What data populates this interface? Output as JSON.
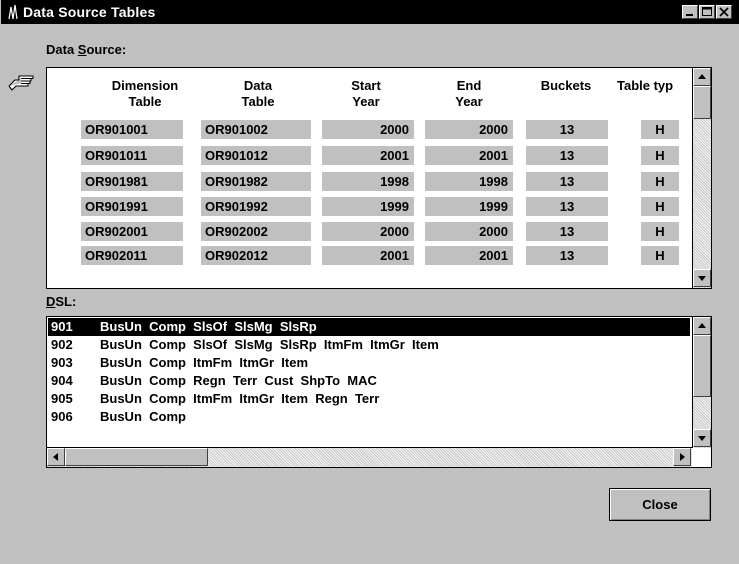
{
  "window": {
    "title": "Data Source Tables"
  },
  "labels": {
    "data_source_pre": "Data ",
    "data_source_key": "S",
    "data_source_post": "ource:",
    "dsl_key": "D",
    "dsl_post": "SL:"
  },
  "columns": [
    {
      "line1": "Dimension",
      "line2": "Table"
    },
    {
      "line1": "Data",
      "line2": "Table"
    },
    {
      "line1": "Start",
      "line2": "Year"
    },
    {
      "line1": "End",
      "line2": "Year"
    },
    {
      "line1": "Buckets",
      "line2": ""
    },
    {
      "line1": "Table typ",
      "line2": ""
    }
  ],
  "rows": [
    {
      "dim": "OR901001",
      "data": "OR901002",
      "start": "2000",
      "end": "2000",
      "buckets": "13",
      "type": "H"
    },
    {
      "dim": "OR901011",
      "data": "OR901012",
      "start": "2001",
      "end": "2001",
      "buckets": "13",
      "type": "H"
    },
    {
      "dim": "OR901981",
      "data": "OR901982",
      "start": "1998",
      "end": "1998",
      "buckets": "13",
      "type": "H"
    },
    {
      "dim": "OR901991",
      "data": "OR901992",
      "start": "1999",
      "end": "1999",
      "buckets": "13",
      "type": "H"
    },
    {
      "dim": "OR902001",
      "data": "OR902002",
      "start": "2000",
      "end": "2000",
      "buckets": "13",
      "type": "H"
    },
    {
      "dim": "OR902011",
      "data": "OR902012",
      "start": "2001",
      "end": "2001",
      "buckets": "13",
      "type": "H"
    }
  ],
  "dsl": [
    {
      "num": "901",
      "text": "BusUn  Comp  SlsOf  SlsMg  SlsRp",
      "selected": true
    },
    {
      "num": "902",
      "text": "BusUn  Comp  SlsOf  SlsMg  SlsRp  ItmFm  ItmGr  Item",
      "selected": false
    },
    {
      "num": "903",
      "text": "BusUn  Comp  ItmFm  ItmGr  Item",
      "selected": false
    },
    {
      "num": "904",
      "text": "BusUn  Comp  Regn  Terr  Cust  ShpTo  MAC",
      "selected": false
    },
    {
      "num": "905",
      "text": "BusUn  Comp  ItmFm  ItmGr  Item  Regn  Terr",
      "selected": false
    },
    {
      "num": "906",
      "text": "BusUn  Comp",
      "selected": false
    }
  ],
  "buttons": {
    "close": "Close"
  },
  "icons": {
    "app": "app-icon",
    "pointer": "hand-pointer-icon"
  }
}
